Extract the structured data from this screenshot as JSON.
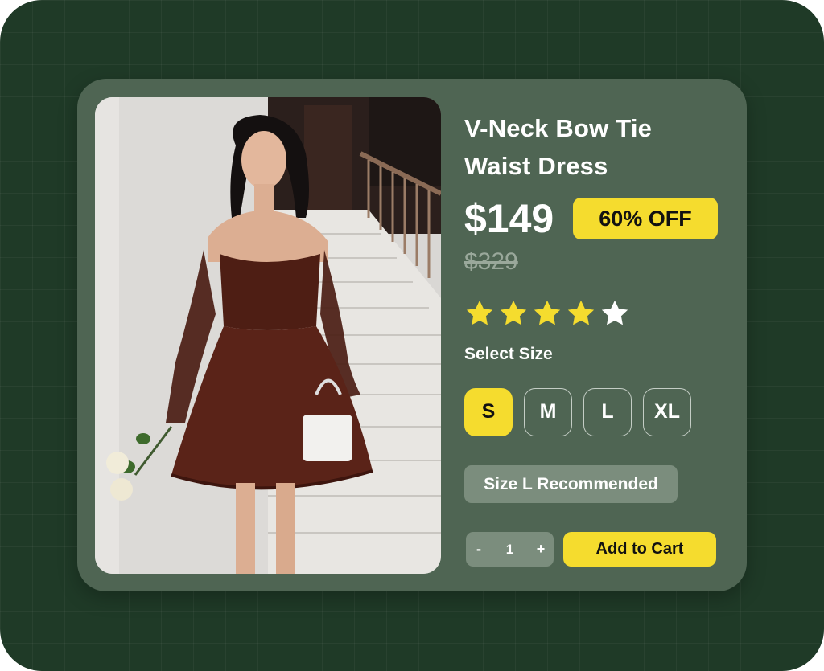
{
  "product": {
    "title_line1": "V-Neck Bow Tie",
    "title_line2": "Waist Dress",
    "price": "$149",
    "discount_badge": "60% OFF",
    "original_price": "$329",
    "rating": 4,
    "rating_max": 5,
    "image_icon": "dress-product-photo"
  },
  "size_selector": {
    "label": "Select Size",
    "options": [
      "S",
      "M",
      "L",
      "XL"
    ],
    "selected": "S"
  },
  "recommendation": "Size L Recommended",
  "quantity": {
    "minus": "-",
    "value": "1",
    "plus": "+"
  },
  "cart": {
    "label": "Add to Cart"
  },
  "colors": {
    "background": "#1f3a27",
    "card": "#4f6553",
    "accent": "#f5dc2e",
    "muted_chip": "#7b8d7d"
  }
}
